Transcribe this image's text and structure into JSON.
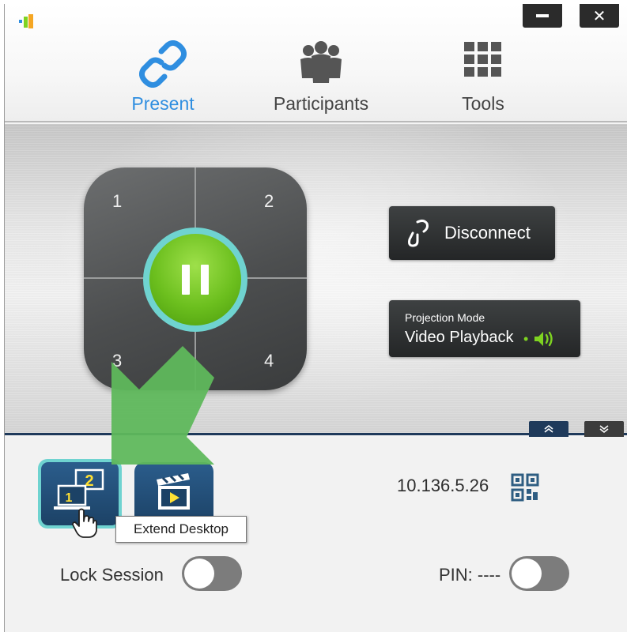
{
  "window": {
    "minimize_icon": "minimize-icon",
    "close_icon": "close-icon",
    "close_glyph": "✕"
  },
  "tabs": [
    {
      "label": "Present",
      "icon": "link-icon",
      "active": true
    },
    {
      "label": "Participants",
      "icon": "people-icon",
      "active": false
    },
    {
      "label": "Tools",
      "icon": "grid-icon",
      "active": false
    }
  ],
  "stage": {
    "quadrants": [
      "1",
      "2",
      "3",
      "4"
    ],
    "pause_icon": "pause-icon",
    "disconnect_label": "Disconnect",
    "projection_mode": {
      "caption": "Projection Mode",
      "value": "Video Playback",
      "separator": "•",
      "audio_icon": "speaker-icon"
    },
    "expand_up_icon": "chevron-double-up-icon",
    "collapse_down_icon": "chevron-double-down-icon"
  },
  "bottom": {
    "extend_desktop_icon": "extend-desktop-icon",
    "video_mode_icon": "clapperboard-play-icon",
    "tooltip": "Extend Desktop",
    "ip_address": "10.136.5.26",
    "qr_icon": "qr-code-icon",
    "lock_session_label": "Lock Session",
    "lock_session_on": false,
    "pin_label": "PIN: ----",
    "pin_on": false
  },
  "colors": {
    "accent_blue": "#2f8ee0",
    "pause_green": "#6cbf1e",
    "teal_ring": "#6fd3d0",
    "navy": "#1f3a5b",
    "annotation_arrow": "#5fb85c"
  }
}
